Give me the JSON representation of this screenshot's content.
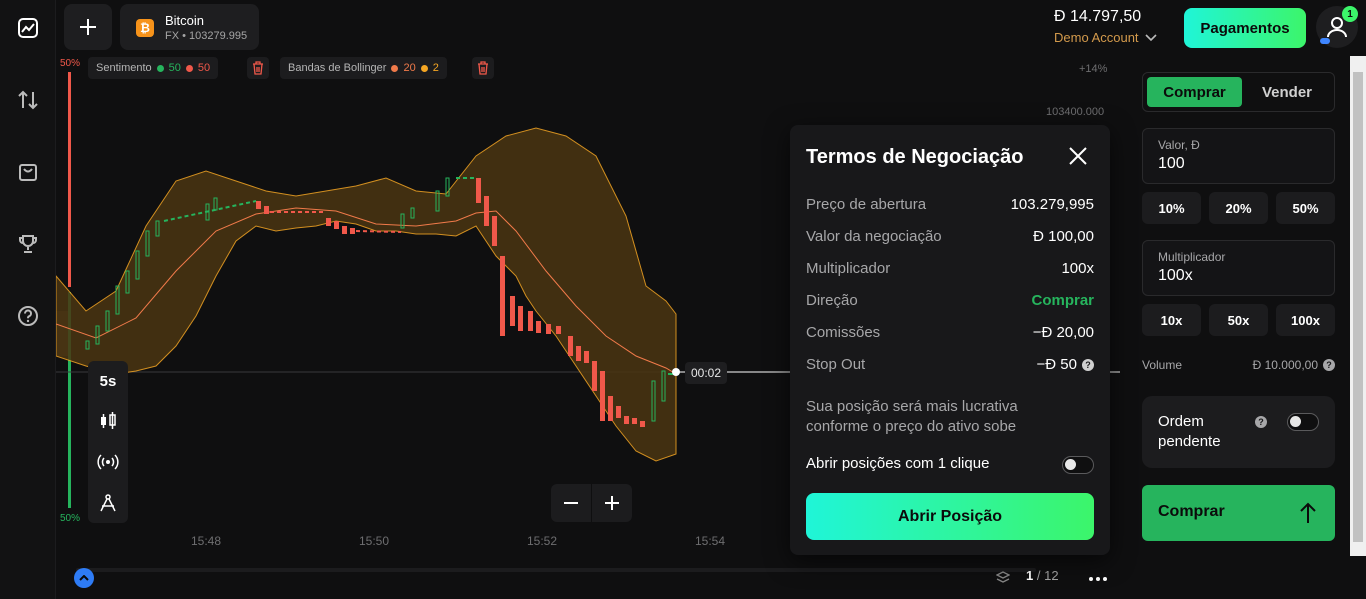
{
  "header": {
    "asset_name": "Bitcoin",
    "asset_sub": "FX • 103279.995",
    "coin_symbol": "₿",
    "balance": "Đ 14.797,50",
    "account_type": "Demo Account",
    "payments_label": "Pagamentos",
    "notification_count": "1"
  },
  "indicators": {
    "sentiment": {
      "label": "Sentimento",
      "up": "50",
      "down": "50"
    },
    "bollinger": {
      "label": "Bandas de Bollinger",
      "period": "20",
      "dev": "2"
    }
  },
  "chart": {
    "pct_top": "50%",
    "pct_bottom": "50%",
    "change_label": "+14%",
    "price_label": "103400.000",
    "times": [
      "15:48",
      "15:50",
      "15:52",
      "15:54"
    ],
    "countdown": "00:02",
    "timeframe": "5s",
    "page_current": "1",
    "page_total": "/ 12"
  },
  "trade_terms": {
    "title": "Termos de Negociação",
    "rows": [
      {
        "key": "Preço de abertura",
        "value": "103.279,995"
      },
      {
        "key": "Valor da negociação",
        "value": "Đ 100,00"
      },
      {
        "key": "Multiplicador",
        "value": "100x"
      },
      {
        "key": "Direção",
        "value": "Comprar"
      },
      {
        "key": "Comissões",
        "value": "−Đ 20,00"
      },
      {
        "key": "Stop Out",
        "value": "−Đ 50"
      }
    ],
    "note": "Sua posição será mais lucrativa conforme o preço do ativo sobe",
    "one_click_label": "Abrir posições com 1 clique",
    "open_button": "Abrir Posição"
  },
  "order_panel": {
    "buy_tab": "Comprar",
    "sell_tab": "Vender",
    "value_label": "Valor, Đ",
    "value": "100",
    "value_chips": [
      "10%",
      "20%",
      "50%"
    ],
    "multiplier_label": "Multiplicador",
    "multiplier": "100x",
    "multiplier_chips": [
      "10x",
      "50x",
      "100x"
    ],
    "volume_label": "Volume",
    "volume_value": "Đ 10.000,00",
    "pending_label": "Ordem pendente",
    "buy_button": "Comprar"
  },
  "colors": {
    "up": "#26b45d",
    "down": "#f0584a",
    "accent_gradient_start": "#1ff5d8",
    "accent_gradient_end": "#3cf56a",
    "band_fill": "#4a3512",
    "band_line": "#f5a623"
  },
  "icons": {
    "nav": [
      "chart-icon",
      "transfer-icon",
      "shopping-bag-icon",
      "trophy-icon",
      "help-icon"
    ],
    "tools": [
      "candles-icon",
      "signal-icon",
      "drawing-icon"
    ]
  }
}
